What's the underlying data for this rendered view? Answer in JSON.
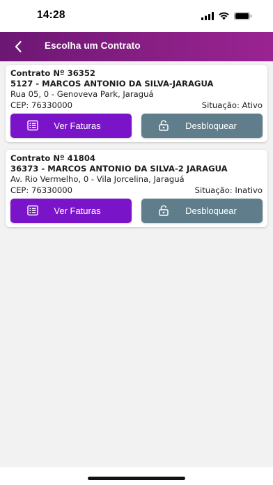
{
  "status_bar": {
    "time": "14:28"
  },
  "app_bar": {
    "title": "Escolha um Contrato"
  },
  "contracts": [
    {
      "title": "Contrato Nº 36352",
      "client": "5127 - MARCOS ANTONIO DA SILVA-JARAGUA",
      "address": "Rua 05, 0 - Genoveva Park, Jaraguá",
      "cep": "CEP: 76330000",
      "situacao": "Situação: Ativo",
      "btn_faturas": "Ver Faturas",
      "btn_desbloquear": "Desbloquear"
    },
    {
      "title": "Contrato Nº 41804",
      "client": "36373 - MARCOS ANTONIO DA SILVA-2 JARAGUA",
      "address": "Av. Rio Vermelho, 0 - Vila Jorcelina, Jaraguá",
      "cep": "CEP: 76330000",
      "situacao": "Situação: Inativo",
      "btn_faturas": "Ver Faturas",
      "btn_desbloquear": "Desbloquear"
    }
  ],
  "colors": {
    "app_bar": "#8a1f86",
    "primary_button": "#7a14c9",
    "secondary_button": "#607d8b",
    "background": "#f2f2f2"
  },
  "icons": {
    "back": "chevron-left-icon",
    "faturas": "list-icon",
    "desbloquear": "unlock-icon",
    "signal": "signal-icon",
    "wifi": "wifi-icon",
    "battery": "battery-icon"
  }
}
